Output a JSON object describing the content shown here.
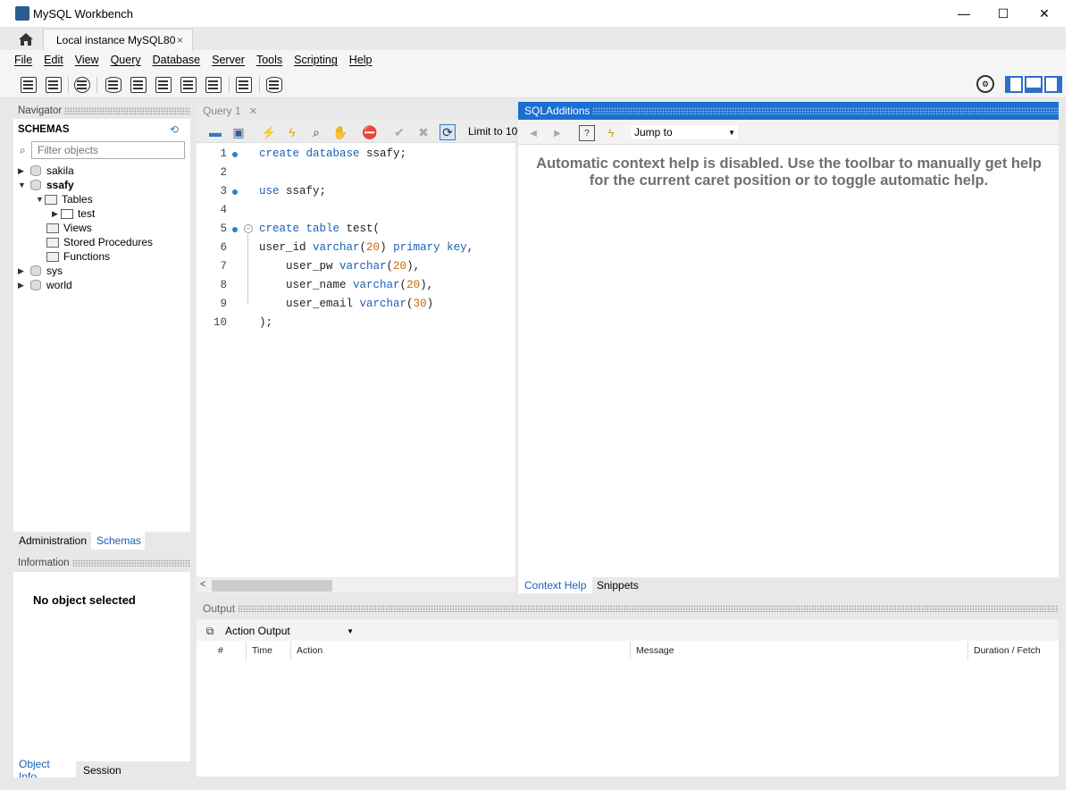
{
  "window": {
    "title": "MySQL Workbench",
    "controls": {
      "minimize": "—",
      "maximize": "☐",
      "close": "✕"
    }
  },
  "tabs": {
    "connection_tab": "Local instance MySQL80",
    "close": "×"
  },
  "menu": [
    "File",
    "Edit",
    "View",
    "Query",
    "Database",
    "Server",
    "Tools",
    "Scripting",
    "Help"
  ],
  "navigator": {
    "header": "Navigator",
    "schemas_label": "SCHEMAS",
    "filter_placeholder": "Filter objects",
    "tree": {
      "sakila": "sakila",
      "ssafy": "ssafy",
      "tables": "Tables",
      "test": "test",
      "views": "Views",
      "procedures": "Stored Procedures",
      "functions": "Functions",
      "sys": "sys",
      "world": "world"
    },
    "bottom_tabs": {
      "administration": "Administration",
      "schemas": "Schemas"
    }
  },
  "information": {
    "header": "Information",
    "message": "No object selected",
    "tabs": {
      "object_info": "Object Info",
      "session": "Session"
    }
  },
  "query": {
    "tab": "Query 1",
    "limit_label": "Limit to 10",
    "line_numbers": [
      "1",
      "2",
      "3",
      "4",
      "5",
      "6",
      "7",
      "8",
      "9",
      "10"
    ],
    "lines": {
      "l1_kw": "create database",
      "l1_rest": " ssafy;",
      "l3_kw": "use",
      "l3_rest": " ssafy;",
      "l5_kw": "create table",
      "l5_rest": " test(",
      "l6_a": "user_id ",
      "l6_kw": "varchar",
      "l6_num": "20",
      "l6_kw2": "primary key",
      "l7_a": "    user_pw ",
      "l7_kw": "varchar",
      "l7_num": "20",
      "l8_a": "    user_name ",
      "l8_kw": "varchar",
      "l8_num": "20",
      "l9_a": "    user_email ",
      "l9_kw": "varchar",
      "l9_num": "30",
      "l10": ");"
    }
  },
  "sql_additions": {
    "header": "SQLAdditions",
    "jump_to": "Jump to",
    "help_text": "Automatic context help is disabled. Use the toolbar to manually get help for the current caret position or to toggle automatic help.",
    "tabs": {
      "context_help": "Context Help",
      "snippets": "Snippets"
    }
  },
  "output": {
    "header": "Output",
    "selector": "Action Output",
    "columns": {
      "num": "#",
      "time": "Time",
      "action": "Action",
      "message": "Message",
      "duration": "Duration / Fetch"
    }
  },
  "colors": {
    "accent": "#1a6fd0",
    "keyword": "#1a5fb4",
    "number": "#c06a00"
  }
}
